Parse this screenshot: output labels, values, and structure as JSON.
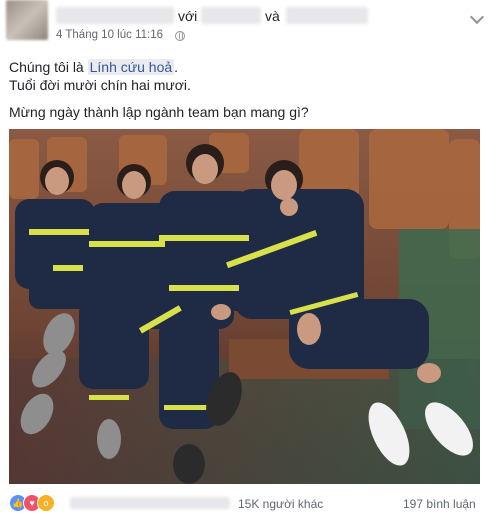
{
  "header": {
    "connector_with": "với",
    "connector_and": "và",
    "timestamp": "4 Tháng 10 lúc 11:16",
    "privacy_icon": "globe-icon",
    "menu_icon": "chevron-down-icon"
  },
  "body": {
    "line1_prefix": "Chúng tôi là ",
    "line1_mention": "Lính cứu hoả",
    "line1_suffix": ".",
    "line2": "Tuổi đời mười chín hai mươi.",
    "line3": "Mừng ngày thành lập ngành team bạn mang gì?"
  },
  "photo": {
    "icon": "group-photo"
  },
  "footer": {
    "reaction_icons": [
      "like-icon",
      "love-icon",
      "wow-icon"
    ],
    "reaction_count": "15K người khác",
    "comment_count": "197 bình luận"
  },
  "colors": {
    "link": "#365899",
    "meta_text": "#616770",
    "uniform": "#1f2a44",
    "reflective_stripe": "#d8e04a",
    "like": "#5890ff",
    "love": "#f25268",
    "wow": "#f7b125"
  }
}
